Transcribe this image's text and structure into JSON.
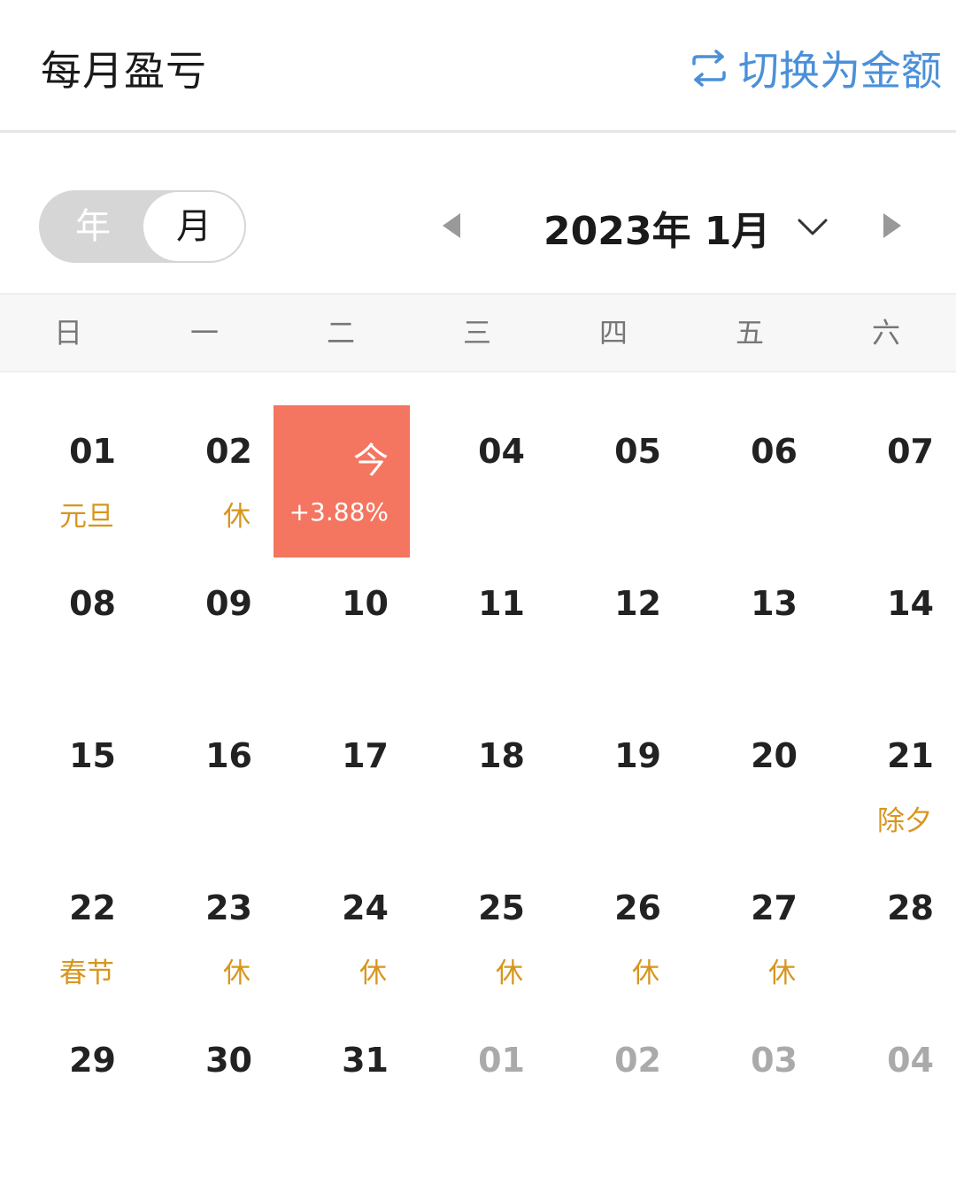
{
  "header": {
    "title": "每月盈亏",
    "switch_label": "切换为金额",
    "switch_icon": "swap-icon",
    "accent_color": "#4a90d9"
  },
  "toggle": {
    "year_label": "年",
    "month_label": "月",
    "selected": "月"
  },
  "navigator": {
    "current": "2023年 1月"
  },
  "weekdays": [
    "日",
    "一",
    "二",
    "三",
    "四",
    "五",
    "六"
  ],
  "colors": {
    "today_bg": "#f47560",
    "holiday_text": "#d7961e",
    "other_month_text": "#aaaaaa"
  },
  "calendar": {
    "weeks": [
      [
        {
          "day": "01",
          "note": "元旦"
        },
        {
          "day": "02",
          "note": "休"
        },
        {
          "day": "今",
          "pnl": "+3.88%",
          "today": true
        },
        {
          "day": "04"
        },
        {
          "day": "05"
        },
        {
          "day": "06"
        },
        {
          "day": "07"
        }
      ],
      [
        {
          "day": "08"
        },
        {
          "day": "09"
        },
        {
          "day": "10"
        },
        {
          "day": "11"
        },
        {
          "day": "12"
        },
        {
          "day": "13"
        },
        {
          "day": "14"
        }
      ],
      [
        {
          "day": "15"
        },
        {
          "day": "16"
        },
        {
          "day": "17"
        },
        {
          "day": "18"
        },
        {
          "day": "19"
        },
        {
          "day": "20"
        },
        {
          "day": "21",
          "note": "除夕"
        }
      ],
      [
        {
          "day": "22",
          "note": "春节"
        },
        {
          "day": "23",
          "note": "休"
        },
        {
          "day": "24",
          "note": "休"
        },
        {
          "day": "25",
          "note": "休"
        },
        {
          "day": "26",
          "note": "休"
        },
        {
          "day": "27",
          "note": "休"
        },
        {
          "day": "28"
        }
      ],
      [
        {
          "day": "29"
        },
        {
          "day": "30"
        },
        {
          "day": "31"
        },
        {
          "day": "01",
          "other": true
        },
        {
          "day": "02",
          "other": true
        },
        {
          "day": "03",
          "other": true
        },
        {
          "day": "04",
          "other": true
        }
      ]
    ]
  }
}
